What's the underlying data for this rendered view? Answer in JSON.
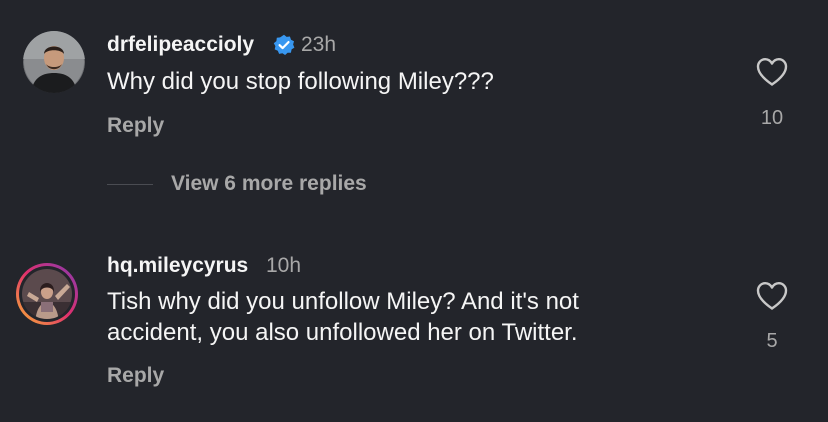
{
  "comments": [
    {
      "username": "drfelipeaccioly",
      "verified": true,
      "timestamp": "23h",
      "text_lines": [
        "Why did you stop following Miley???"
      ],
      "reply_label": "Reply",
      "like_count": "10",
      "avatar": "profile-photo",
      "like_icon": "heart-outline-icon"
    },
    {
      "username": "hq.mileycyrus",
      "verified": false,
      "timestamp": "10h",
      "text_lines": [
        "Tish why did you unfollow Miley? And it's not",
        "accident, you also unfollowed her on Twitter."
      ],
      "reply_label": "Reply",
      "like_count": "5",
      "avatar": "profile-photo-with-story-ring",
      "like_icon": "heart-outline-icon"
    }
  ],
  "thread": {
    "view_replies_label": "View 6 more replies"
  },
  "colors": {
    "background": "#23252b",
    "primary_text": "#f5f5f5",
    "secondary_text": "#a8a8a8",
    "verified_badge": "#3897f0",
    "story_ring": [
      "#f9b633",
      "#e1306c",
      "#833ab4"
    ]
  }
}
